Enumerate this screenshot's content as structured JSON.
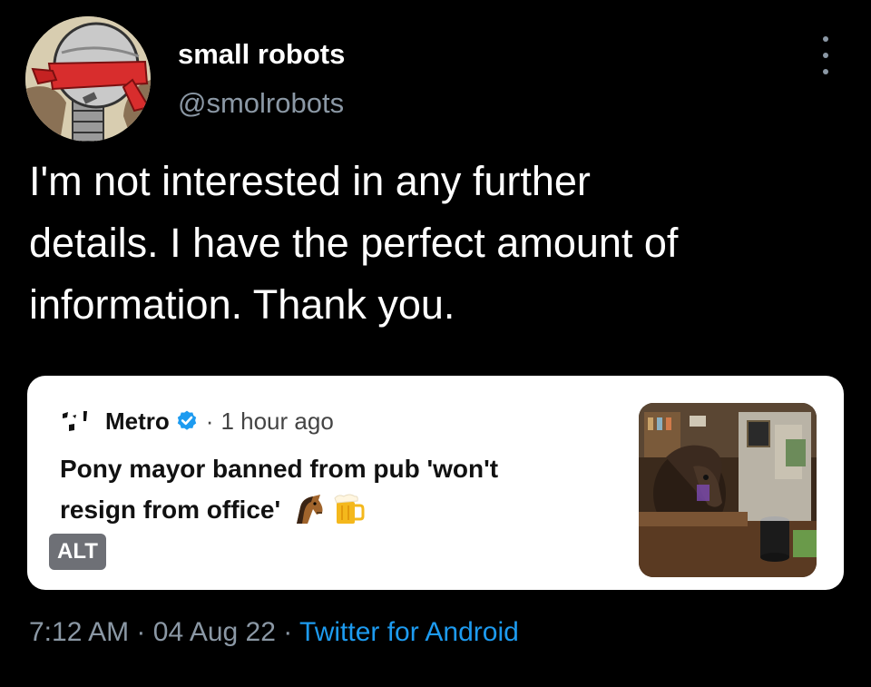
{
  "author": {
    "display_name": "small robots",
    "handle": "@smolrobots",
    "avatar_icon": "blindfolded-robot-avatar"
  },
  "tweet": {
    "text_lines": [
      "I'm not interested in any further",
      "details. I have the perfect amount of",
      "information. Thank you."
    ]
  },
  "quoted": {
    "source_name": "Metro",
    "verified_icon": "verified-badge-icon",
    "separator": "·",
    "time_ago": "1 hour ago",
    "headline_lines": [
      "Pony mayor banned from pub 'won't",
      "resign from office'"
    ],
    "emoji": [
      "horse-face-emoji",
      "beer-mug-emoji"
    ],
    "alt_label": "ALT",
    "thumbnail": "pony-in-pub-photo"
  },
  "footer": {
    "time": "7:12 AM",
    "sep1": "·",
    "date": "04 Aug 22",
    "sep2": "·",
    "client": "Twitter for Android"
  },
  "colors": {
    "background": "#000000",
    "text_primary": "#ffffff",
    "text_secondary": "#8b98a5",
    "link": "#1d9bf0",
    "verified": "#1d9bf0",
    "card_background": "#ffffff"
  }
}
